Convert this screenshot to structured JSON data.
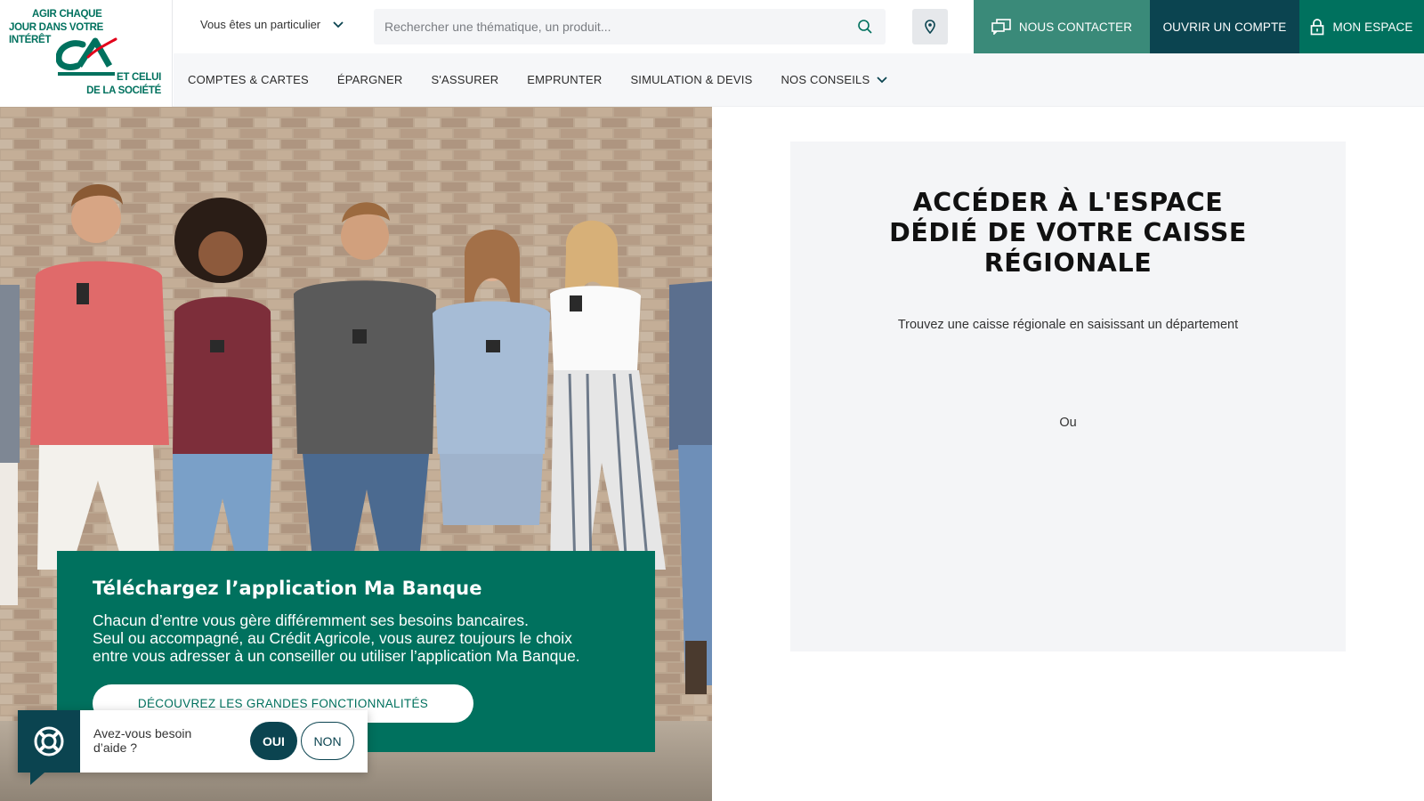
{
  "logo": {
    "tagline_top": [
      "AGIR CHAQUE",
      "JOUR DANS VOTRE",
      "INTÉRÊT"
    ],
    "tagline_bottom": [
      "ET CELUI",
      "DE LA SOCIÉTÉ"
    ],
    "mark_text": "CA"
  },
  "header": {
    "profile_label": "Vous êtes un particulier",
    "search_placeholder": "Rechercher une thématique, un produit...",
    "contact_label": "NOUS CONTACTER",
    "open_account_label": "OUVRIR UN COMPTE",
    "my_space_label": "MON ESPACE"
  },
  "nav": {
    "items": [
      {
        "label": "COMPTES & CARTES"
      },
      {
        "label": "ÉPARGNER"
      },
      {
        "label": "S'ASSURER"
      },
      {
        "label": "EMPRUNTER"
      },
      {
        "label": "SIMULATION & DEVIS"
      },
      {
        "label": "NOS CONSEILS"
      }
    ]
  },
  "promo": {
    "title": "Téléchargez l’application Ma Banque",
    "body_lines": [
      "Chacun d’entre vous gère différemment ses besoins bancaires.",
      "Seul ou accompagné, au Crédit Agricole, vous aurez toujours le choix",
      "entre vous adresser à un conseiller ou utiliser l’application Ma Banque."
    ],
    "button_label": "DÉCOUVREZ LES GRANDES FONCTIONNALITÉS"
  },
  "panel": {
    "title": "ACCÉDER À L'ESPACE DÉDIÉ DE VOTRE CAISSE RÉGIONALE",
    "hint": "Trouvez une caisse régionale en saisissant un département",
    "or": "Ou"
  },
  "help": {
    "question": "Avez-vous besoin d’aide ?",
    "yes": "OUI",
    "no": "NON"
  },
  "colors": {
    "brand_green": "#00715e",
    "dark_teal": "#0b4450",
    "contact_green": "#3a8a79",
    "accent_red": "#e2001a"
  }
}
